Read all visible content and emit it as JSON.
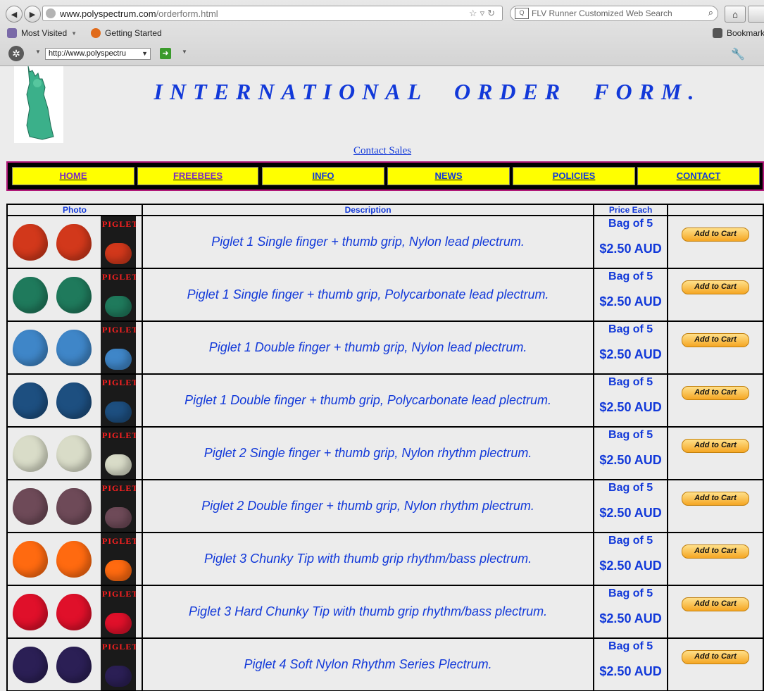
{
  "browser": {
    "url_host": "www.polyspectrum.com",
    "url_path": "/orderform.html",
    "search_placeholder": "FLV Runner Customized Web Search",
    "mini_url": "http://www.polyspectru",
    "bookmarks": [
      {
        "label": "Most Visited"
      },
      {
        "label": "Getting Started"
      },
      {
        "label": "Bookmarks"
      }
    ]
  },
  "page": {
    "title": "INTERNATIONAL ORDER FORM.",
    "contact_sales": "Contact Sales",
    "nav": [
      {
        "label": "HOME",
        "color": "#7b2bbf"
      },
      {
        "label": "FREEBEES",
        "color": "#7b2bbf"
      },
      {
        "label": "INFO",
        "color": "#1239d9"
      },
      {
        "label": "NEWS",
        "color": "#1239d9"
      },
      {
        "label": "POLICIES",
        "color": "#1239d9"
      },
      {
        "label": "CONTACT",
        "color": "#1239d9"
      }
    ]
  },
  "table": {
    "headers": {
      "photo": "Photo",
      "description": "Description",
      "price": "Price Each",
      "cart": ""
    },
    "cart_label": "Add to Cart",
    "rows": [
      {
        "description": "Piglet 1 Single finger + thumb grip, Nylon lead plectrum.",
        "bag": "Bag of 5",
        "price": "$2.50 AUD",
        "color": "#d2381b"
      },
      {
        "description": "Piglet 1 Single finger + thumb grip, Polycarbonate lead plectrum.",
        "bag": "Bag of 5",
        "price": "$2.50 AUD",
        "color": "#1f7a5c"
      },
      {
        "description": "Piglet 1 Double finger + thumb grip, Nylon lead plectrum.",
        "bag": "Bag of 5",
        "price": "$2.50 AUD",
        "color": "#3f86c8"
      },
      {
        "description": "Piglet 1 Double finger + thumb grip, Polycarbonate lead plectrum.",
        "bag": "Bag of 5",
        "price": "$2.50 AUD",
        "color": "#1d4f80"
      },
      {
        "description": "Piglet 2 Single finger + thumb grip, Nylon rhythm plectrum.",
        "bag": "Bag of 5",
        "price": "$2.50 AUD",
        "color": "#d9dcc8"
      },
      {
        "description": "Piglet 2 Double finger + thumb grip, Nylon rhythm plectrum.",
        "bag": "Bag of 5",
        "price": "$2.50 AUD",
        "color": "#6e4a58"
      },
      {
        "description": "Piglet 3 Chunky Tip with thumb grip rhythm/bass plectrum.",
        "bag": "Bag of 5",
        "price": "$2.50 AUD",
        "color": "#ff6a10"
      },
      {
        "description": "Piglet 3 Hard Chunky Tip with thumb grip rhythm/bass plectrum.",
        "bag": "Bag of 5",
        "price": "$2.50 AUD",
        "color": "#e0102a"
      },
      {
        "description": "Piglet 4 Soft Nylon Rhythm Series Plectrum.",
        "bag": "Bag of 5",
        "price": "$2.50 AUD",
        "color": "#2b1f55"
      }
    ]
  }
}
